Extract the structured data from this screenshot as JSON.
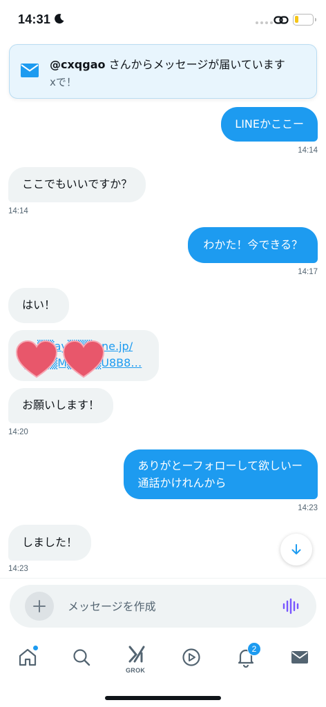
{
  "status_bar": {
    "time": "14:31"
  },
  "banner": {
    "handle": "@cxqgao",
    "message": " さんからメッセージが届いています",
    "subtitle": "xで！"
  },
  "messages": [
    {
      "direction": "outgoing",
      "text": "LINEかここー",
      "time": "14:14"
    },
    {
      "direction": "incoming",
      "text": "ここでもいいですか？",
      "time": "14:14"
    },
    {
      "direction": "outgoing",
      "text": "わかた！今できる？",
      "time": "14:17"
    },
    {
      "direction": "incoming",
      "text": "はい！"
    },
    {
      "direction": "incoming",
      "type": "link",
      "line1": "pa▒▒ay▒▒▒y.ne.jp/",
      "line2": "▒▒▒▒M▒▒▒▒U8B8…"
    },
    {
      "direction": "incoming",
      "text": "お願いします！",
      "time": "14:20"
    },
    {
      "direction": "outgoing",
      "line1": "ありがとーフォローして欲しいー",
      "line2": "通話かけれんから",
      "time": "14:23"
    },
    {
      "direction": "incoming",
      "text": "しました！",
      "time": "14:23"
    }
  ],
  "composer": {
    "placeholder": "メッセージを作成"
  },
  "tab_bar": {
    "items": [
      "home-icon",
      "search-icon",
      "grok-icon",
      "video-icon",
      "notifications-icon",
      "messages-icon"
    ],
    "grok_label": "GROK",
    "notification_count": "2"
  },
  "colors": {
    "accent": "#1d9bf0",
    "incoming_bubble": "#eff3f4",
    "banner_bg": "#e8f5fd",
    "sticker_heart": "#e8576b"
  }
}
